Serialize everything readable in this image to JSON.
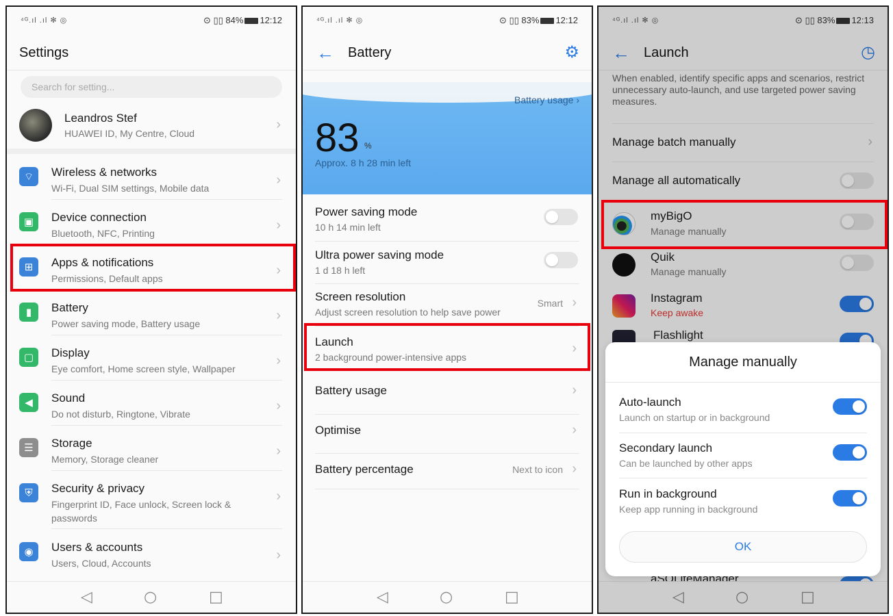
{
  "colors": {
    "accent": "#2a7be4",
    "highlight": "#e8000d",
    "keep_awake": "#e53935"
  },
  "panel1": {
    "status": {
      "left": "⁴ᴳ.ıl .ıl ✻ ◎",
      "right": "⊙ ▯▯ 84%",
      "time": "12:12"
    },
    "title": "Settings",
    "search_placeholder": "Search for setting...",
    "profile": {
      "name": "Leandros Stef",
      "subtitle": "HUAWEI ID, My Centre, Cloud"
    },
    "items": [
      {
        "title": "Wireless & networks",
        "subtitle": "Wi-Fi, Dual SIM settings, Mobile data",
        "icon": "wifi-icon",
        "glyph": "⌔",
        "color": "#3b82d9"
      },
      {
        "title": "Device connection",
        "subtitle": "Bluetooth, NFC, Printing",
        "icon": "device-connection-icon",
        "glyph": "▣",
        "color": "#33b86a"
      },
      {
        "title": "Apps & notifications",
        "subtitle": "Permissions, Default apps",
        "icon": "apps-icon",
        "glyph": "⊞",
        "color": "#3b82d9"
      },
      {
        "title": "Battery",
        "subtitle": "Power saving mode, Battery usage",
        "icon": "battery-icon",
        "glyph": "▮",
        "color": "#33b86a"
      },
      {
        "title": "Display",
        "subtitle": "Eye comfort, Home screen style, Wallpaper",
        "icon": "display-icon",
        "glyph": "▢",
        "color": "#33b86a"
      },
      {
        "title": "Sound",
        "subtitle": "Do not disturb, Ringtone, Vibrate",
        "icon": "sound-icon",
        "glyph": "◀",
        "color": "#33b86a"
      },
      {
        "title": "Storage",
        "subtitle": "Memory, Storage cleaner",
        "icon": "storage-icon",
        "glyph": "☰",
        "color": "#8e8e8e"
      },
      {
        "title": "Security & privacy",
        "subtitle": "Fingerprint ID, Face unlock, Screen lock & passwords",
        "icon": "shield-icon",
        "glyph": "⛨",
        "color": "#3b82d9"
      },
      {
        "title": "Users & accounts",
        "subtitle": "Users, Cloud, Accounts",
        "icon": "user-icon",
        "glyph": "◉",
        "color": "#3b82d9"
      }
    ]
  },
  "panel2": {
    "status": {
      "left": "⁴ᴳ.ıl .ıl ✻ ◎",
      "right": "⊙ ▯▯ 83%",
      "time": "12:12"
    },
    "title": "Battery",
    "battery_usage_link": "Battery usage",
    "level": "83",
    "level_unit": "%",
    "remaining": "Approx. 8 h 28 min left",
    "rows": {
      "power_saving": {
        "title": "Power saving mode",
        "subtitle": "10 h 14 min left",
        "on": false
      },
      "ultra_power_saving": {
        "title": "Ultra power saving mode",
        "subtitle": "1 d 18 h left",
        "on": false
      },
      "screen_resolution": {
        "title": "Screen resolution",
        "subtitle": "Adjust screen resolution to help save power",
        "value": "Smart"
      },
      "launch": {
        "title": "Launch",
        "subtitle": "2 background power-intensive apps"
      },
      "battery_usage": {
        "title": "Battery usage"
      },
      "optimise": {
        "title": "Optimise"
      },
      "battery_percentage": {
        "title": "Battery percentage",
        "value": "Next to icon"
      }
    }
  },
  "panel3": {
    "status": {
      "left": "⁴ᴳ.ıl .ıl ✻ ◎",
      "right": "⊙ ▯▯ 83%",
      "time": "12:13"
    },
    "title": "Launch",
    "description": "When enabled, identify specific apps and scenarios, restrict unnecessary auto-launch, and use targeted power saving measures.",
    "manage_batch": "Manage batch manually",
    "manage_all": "Manage all automatically",
    "apps": [
      {
        "name": "myBigO",
        "status": "Manage manually",
        "on": false
      },
      {
        "name": "Quik",
        "status": "Manage manually",
        "on": false
      },
      {
        "name": "Instagram",
        "status": "Keep awake",
        "on": true
      },
      {
        "name": "Flashlight",
        "status": "",
        "on": true
      },
      {
        "name": "aSQLiteManager",
        "status": "",
        "on": true
      }
    ],
    "dialog": {
      "title": "Manage manually",
      "options": [
        {
          "title": "Auto-launch",
          "subtitle": "Launch on startup or in background",
          "on": true
        },
        {
          "title": "Secondary launch",
          "subtitle": "Can be launched by other apps",
          "on": true
        },
        {
          "title": "Run in background",
          "subtitle": "Keep app running in background",
          "on": true
        }
      ],
      "ok": "OK"
    }
  },
  "nav": {
    "back": "◁",
    "home": "○",
    "recents": "□"
  }
}
